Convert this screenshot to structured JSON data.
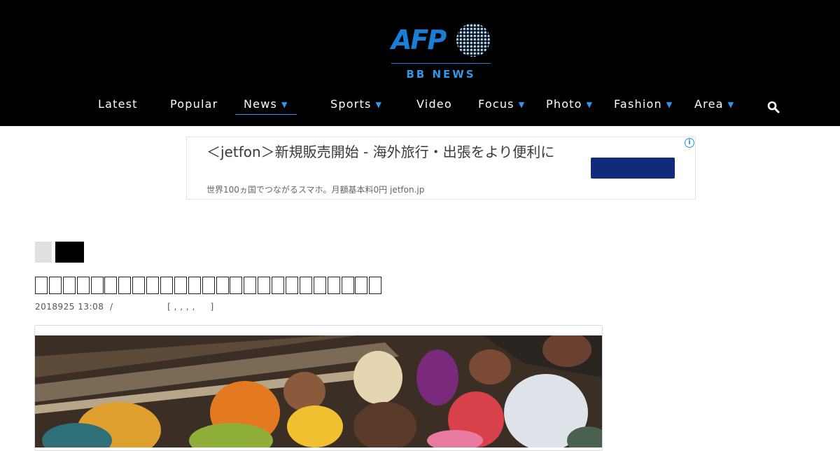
{
  "header": {
    "logo_mark": "AFP",
    "logo_sub": "BB NEWS"
  },
  "nav": {
    "items": [
      {
        "label": "Latest",
        "dropdown": false
      },
      {
        "label": "Popular",
        "dropdown": false
      },
      {
        "label": "News",
        "dropdown": true,
        "active": true
      },
      {
        "label": "Sports",
        "dropdown": true
      },
      {
        "label": "Video",
        "dropdown": false
      },
      {
        "label": "Focus",
        "dropdown": true
      },
      {
        "label": "Photo",
        "dropdown": true
      },
      {
        "label": "Fashion",
        "dropdown": true
      },
      {
        "label": "Area",
        "dropdown": true
      }
    ],
    "chevron_glyph": "⌄",
    "search_icon": "search-icon"
  },
  "ad": {
    "title": "＜jetfon＞新規販売開始 - 海外旅行・出張をより便利に",
    "subtitle": "世界100ヵ国でつながるスマホ。月額基本料0円 jetfon.jp",
    "info_glyph": "i",
    "button_color": "#102a7c"
  },
  "article": {
    "title_box_count": 25,
    "meta": "2018925 13:08  /                  [ , , , ,     ]",
    "photo_description_icon": "refugee-boat-photo"
  },
  "colors": {
    "header_bg": "#000000",
    "accent": "#2e97e6",
    "logo_blue": "#1a7fd4"
  }
}
